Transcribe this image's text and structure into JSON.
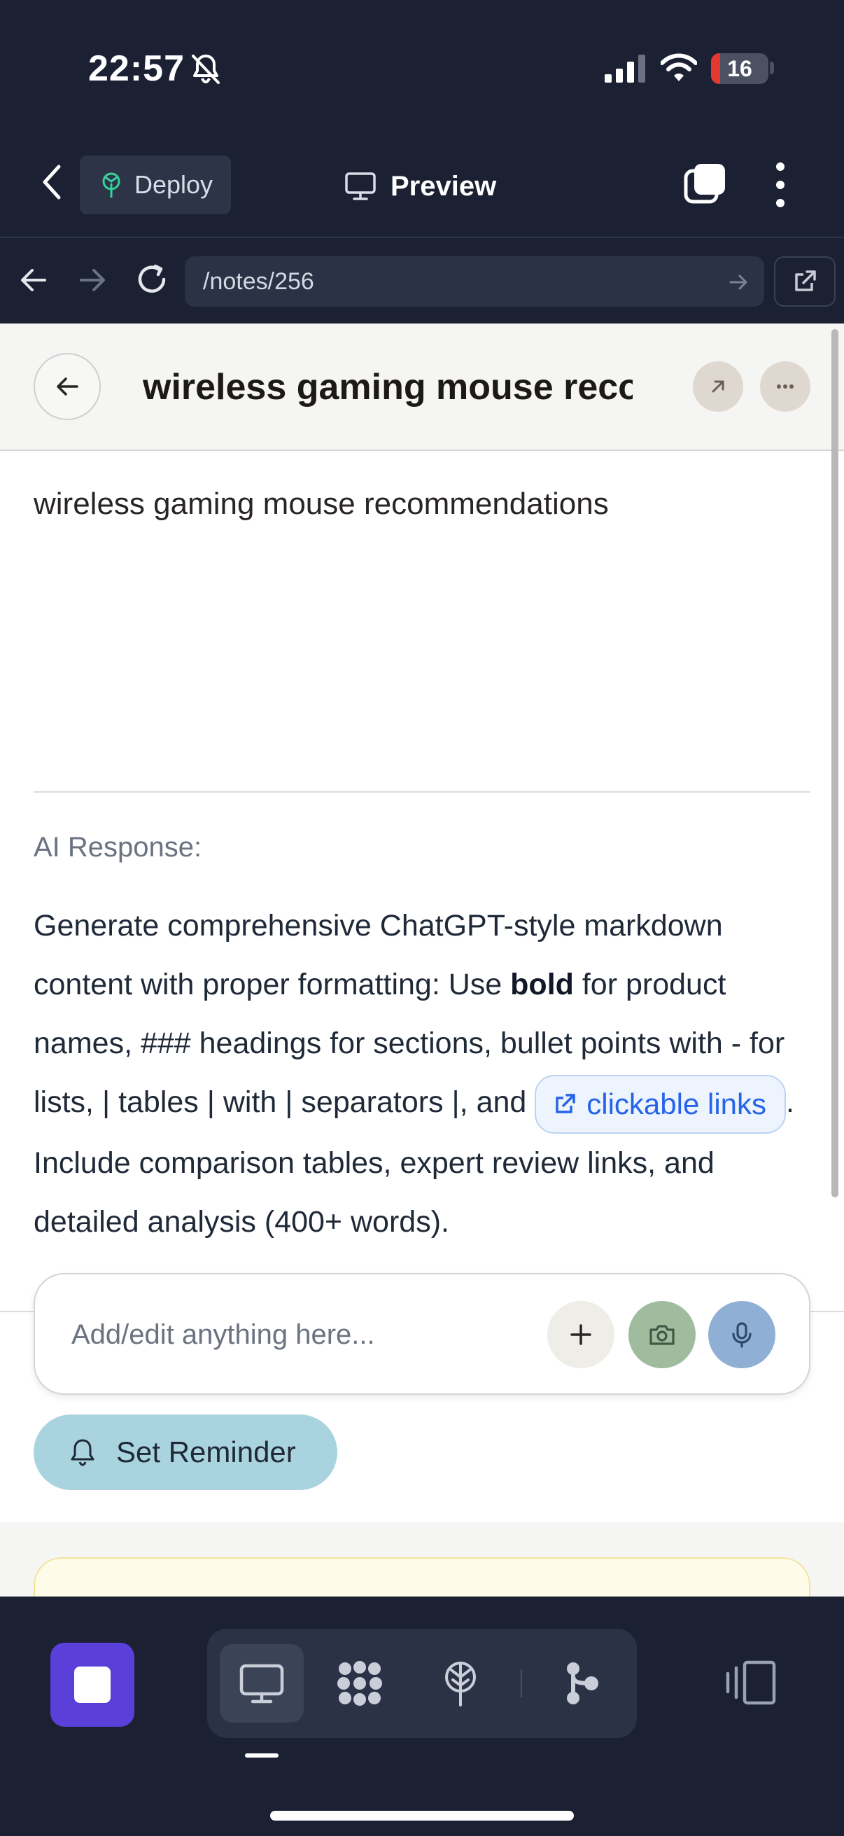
{
  "status_bar": {
    "time": "22:57",
    "battery_level": "16",
    "battery_fraction": 0.16,
    "colors": {
      "battery_low": "#e5382f"
    },
    "icons": [
      "bell-slash-icon",
      "cellular-signal-icon",
      "wifi-icon",
      "battery-icon"
    ]
  },
  "app_bar": {
    "deploy_label": "Deploy",
    "title": "Preview",
    "icons": [
      "back-chevron-icon",
      "deploy-tree-icon",
      "monitor-icon",
      "tabs-icon",
      "more-vertical-icon"
    ]
  },
  "browser": {
    "url": "/notes/256",
    "icons": [
      "back-arrow-icon",
      "forward-arrow-icon",
      "reload-icon",
      "go-arrow-icon",
      "open-external-icon"
    ]
  },
  "note": {
    "title": "wireless gaming mouse recommendations",
    "body": "wireless gaming mouse recommendations",
    "ai_label": "AI Response:",
    "ai_text": {
      "part1": "Generate comprehensive ChatGPT-style markdown content with proper formatting: Use ",
      "bold": "bold",
      "part2": " for product names, ### headings for sections, bullet points with - for lists, | tables | with | separators |, and ",
      "link": "clickable links",
      "part3": ". Include comparison tables, expert review links, and detailed analysis (400+ words)."
    }
  },
  "composer": {
    "placeholder": "Add/edit anything here...",
    "colors": {
      "camera": "#9fbc9f",
      "mic": "#8fb0d4"
    }
  },
  "reminder": {
    "label": "Set Reminder",
    "color": "#a9d3de"
  },
  "dock": {
    "accent": "#5b3fd9",
    "icons": [
      "stop-icon",
      "monitor-icon",
      "grid-dots-icon",
      "tree-icon",
      "branch-icon",
      "layout-panel-icon"
    ],
    "active_tool": "monitor-icon"
  }
}
